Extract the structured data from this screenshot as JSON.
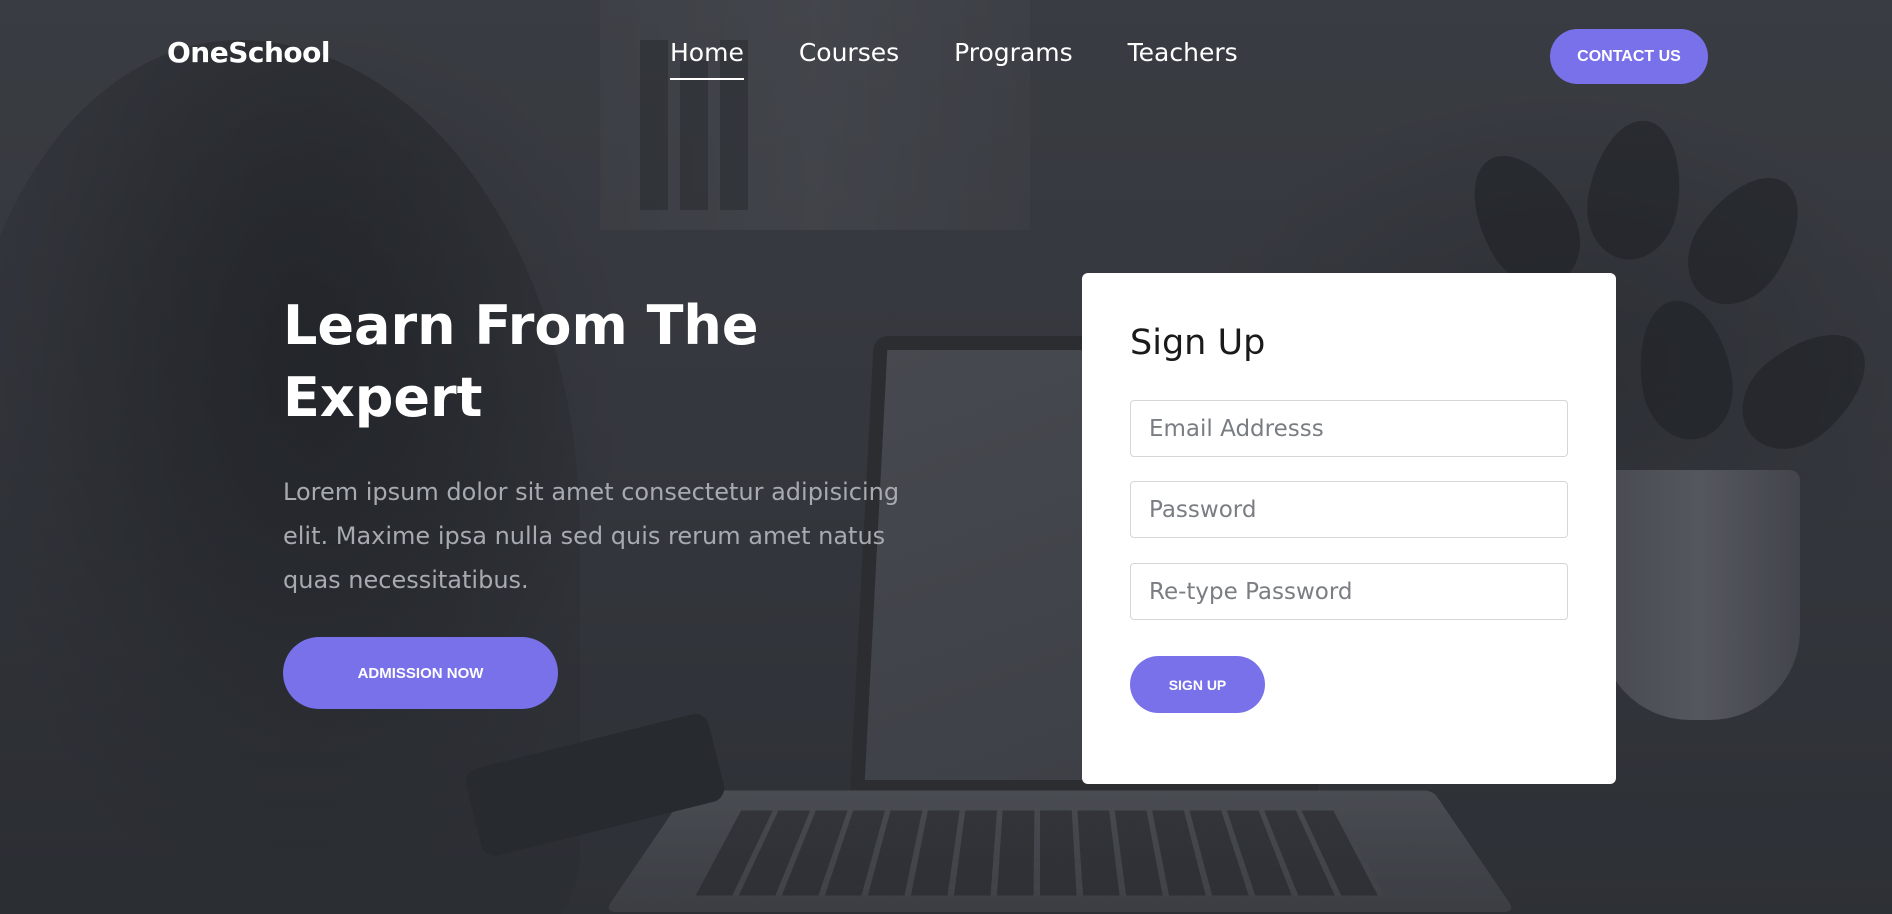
{
  "brand": {
    "logo_text": "OneSchool",
    "accent_color": "#7971ea"
  },
  "nav": {
    "items": [
      {
        "label": "Home",
        "active": true
      },
      {
        "label": "Courses",
        "active": false
      },
      {
        "label": "Programs",
        "active": false
      },
      {
        "label": "Teachers",
        "active": false
      }
    ],
    "contact_label": "CONTACT US"
  },
  "hero": {
    "title": "Learn From The Expert",
    "description": "Lorem ipsum dolor sit amet consectetur adipisicing elit. Maxime ipsa nulla sed quis rerum amet natus quas necessitatibus.",
    "cta_label": "ADMISSION NOW"
  },
  "signup": {
    "title": "Sign Up",
    "email_placeholder": "Email Addresss",
    "email_value": "",
    "password_placeholder": "Password",
    "password_value": "",
    "retype_placeholder": "Re-type Password",
    "retype_value": "",
    "submit_label": "SIGN UP"
  }
}
